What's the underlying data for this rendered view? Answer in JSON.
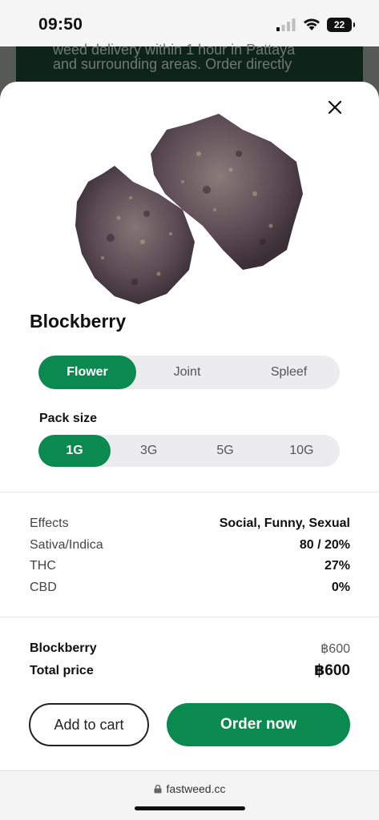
{
  "status": {
    "time": "09:50",
    "battery": "22"
  },
  "background": {
    "line1": "weed delivery within 1 hour in Pattaya",
    "line2": "and surrounding areas. Order directly"
  },
  "product": {
    "name": "Blockberry",
    "type_options": [
      {
        "label": "Flower",
        "selected": true
      },
      {
        "label": "Joint",
        "selected": false
      },
      {
        "label": "Spleef",
        "selected": false
      }
    ],
    "pack_size_label": "Pack size",
    "pack_options": [
      {
        "label": "1G",
        "selected": true
      },
      {
        "label": "3G",
        "selected": false
      },
      {
        "label": "5G",
        "selected": false
      },
      {
        "label": "10G",
        "selected": false
      }
    ],
    "specs": [
      {
        "key": "Effects",
        "value": "Social, Funny, Sexual"
      },
      {
        "key": "Sativa/Indica",
        "value": "80 / 20%"
      },
      {
        "key": "THC",
        "value": "27%"
      },
      {
        "key": "CBD",
        "value": "0%"
      }
    ]
  },
  "pricing": {
    "item_label": "Blockberry",
    "item_price": "฿600",
    "total_label": "Total price",
    "total_price": "฿600"
  },
  "actions": {
    "add_to_cart": "Add to cart",
    "order_now": "Order now"
  },
  "browser": {
    "url": "fastweed.cc"
  },
  "colors": {
    "accent": "#0b8a4f",
    "segment_bg": "#ececef"
  }
}
